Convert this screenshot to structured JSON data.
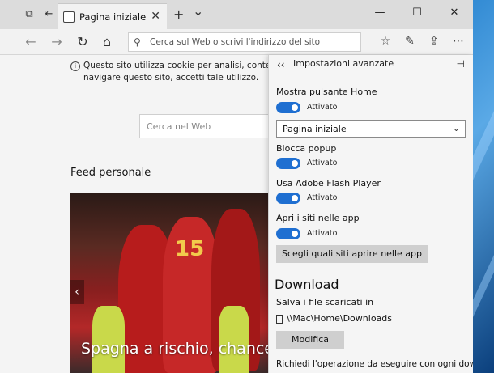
{
  "tabs": {
    "active_title": "Pagina iniziale",
    "close_symbol": "✕",
    "new_tab_symbol": "+",
    "list_symbol": "⌄"
  },
  "window_controls": {
    "minimize": "—",
    "maximize": "☐",
    "close": "✕"
  },
  "address_bar": {
    "placeholder": "Cerca sul Web o scrivi l'indirizzo del sito"
  },
  "page": {
    "cookie_notice": "Questo sito utilizza cookie per analisi, contenuti personal... navigare questo sito, accetti tale utilizzo.",
    "cookie_line1": "Questo sito utilizza cookie per analisi, contenuti personal",
    "cookie_line2": "navigare questo sito, accetti tale utilizzo.",
    "search_placeholder": "Cerca nel Web",
    "feed_title": "Feed personale",
    "feed_caption": "Spagna a rischio, chance pe"
  },
  "settings": {
    "title": "Impostazioni avanzate",
    "show_home_label": "Mostra pulsante Home",
    "show_home_state": "Attivato",
    "home_select_value": "Pagina iniziale",
    "block_popup_label": "Blocca popup",
    "block_popup_state": "Attivato",
    "flash_label": "Usa Adobe Flash Player",
    "flash_state": "Attivato",
    "open_apps_label": "Apri i siti nelle app",
    "open_apps_state": "Attivato",
    "choose_sites_button": "Scegli quali siti aprire nelle app",
    "download_title": "Download",
    "save_files_label": "Salva i file scaricati in",
    "download_path": "\\\\Mac\\Home\\Downloads",
    "change_button": "Modifica",
    "ask_text": "Richiedi l'operazione da eseguire con ogni download"
  },
  "colors": {
    "accent": "#1f6fd1",
    "panel_bg": "#f5f5f5",
    "tabbar_bg": "#dcdcdc"
  }
}
